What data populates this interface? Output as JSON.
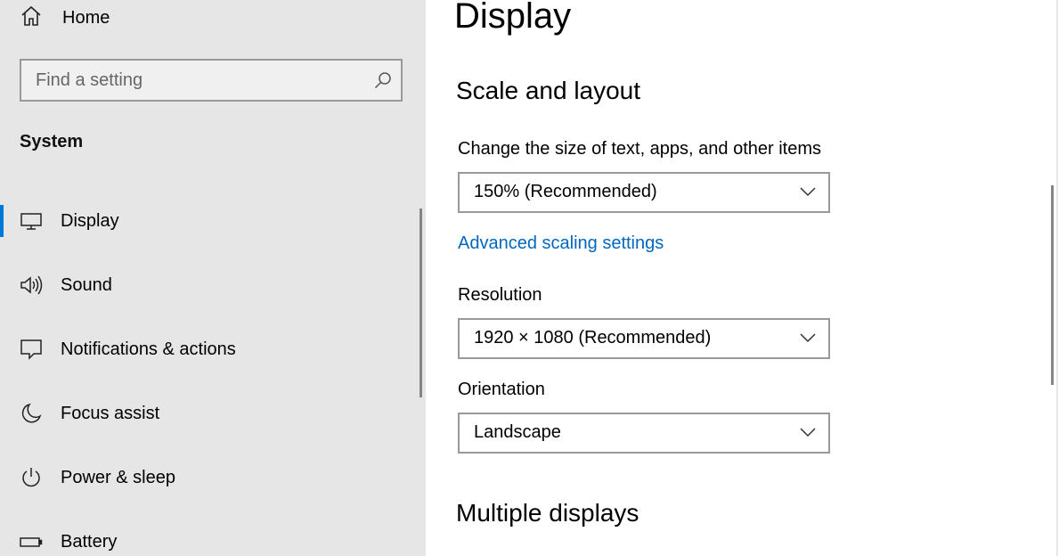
{
  "sidebar": {
    "home_label": "Home",
    "search": {
      "placeholder": "Find a setting",
      "value": ""
    },
    "section_label": "System",
    "items": [
      {
        "label": "Display",
        "icon": "monitor-icon",
        "active": true
      },
      {
        "label": "Sound",
        "icon": "speaker-icon",
        "active": false
      },
      {
        "label": "Notifications & actions",
        "icon": "notification-icon",
        "active": false
      },
      {
        "label": "Focus assist",
        "icon": "moon-icon",
        "active": false
      },
      {
        "label": "Power & sleep",
        "icon": "power-icon",
        "active": false
      },
      {
        "label": "Battery",
        "icon": "battery-icon",
        "active": false
      }
    ]
  },
  "main": {
    "title": "Display",
    "scale_section": {
      "heading": "Scale and layout",
      "size_label": "Change the size of text, apps, and other items",
      "size_value": "150% (Recommended)",
      "advanced_link": "Advanced scaling settings",
      "resolution_label": "Resolution",
      "resolution_value": "1920 × 1080 (Recommended)",
      "orientation_label": "Orientation",
      "orientation_value": "Landscape"
    },
    "multiple_displays_heading": "Multiple displays"
  },
  "colors": {
    "sidebar_bg": "#e6e6e6",
    "accent": "#0078d7",
    "link": "#0067c0"
  }
}
